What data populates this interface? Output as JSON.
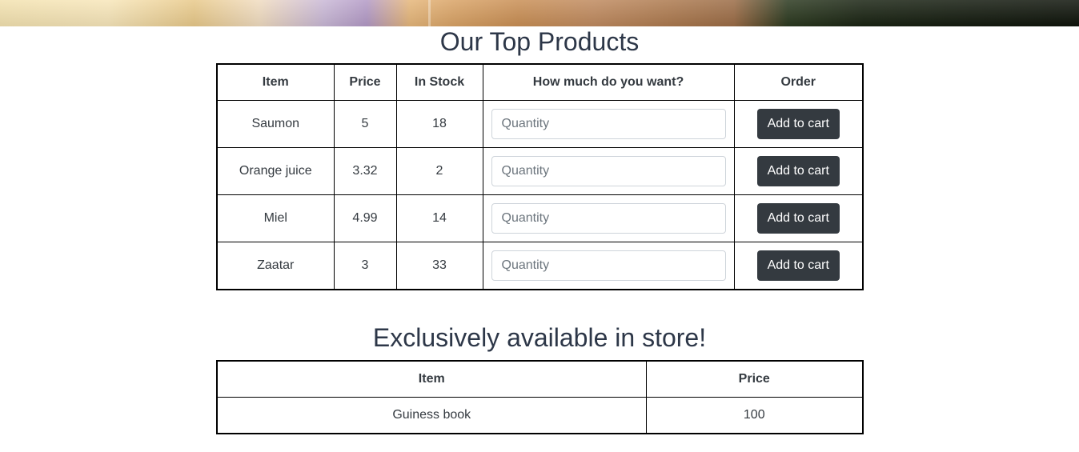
{
  "top_products": {
    "title": "Our Top Products",
    "headers": {
      "item": "Item",
      "price": "Price",
      "stock": "In Stock",
      "quantity": "How much do you want?",
      "order": "Order"
    },
    "rows": [
      {
        "item": "Saumon",
        "price": "5",
        "stock": "18",
        "quantity_placeholder": "Quantity",
        "button": "Add to cart"
      },
      {
        "item": "Orange juice",
        "price": "3.32",
        "stock": "2",
        "quantity_placeholder": "Quantity",
        "button": "Add to cart"
      },
      {
        "item": "Miel",
        "price": "4.99",
        "stock": "14",
        "quantity_placeholder": "Quantity",
        "button": "Add to cart"
      },
      {
        "item": "Zaatar",
        "price": "3",
        "stock": "33",
        "quantity_placeholder": "Quantity",
        "button": "Add to cart"
      }
    ]
  },
  "store_exclusive": {
    "title": "Exclusively available in store!",
    "headers": {
      "item": "Item",
      "price": "Price"
    },
    "rows": [
      {
        "item": "Guiness book",
        "price": "100"
      }
    ]
  },
  "colors": {
    "button_bg": "#343a40",
    "heading": "#2d3748",
    "text": "#343a40"
  }
}
